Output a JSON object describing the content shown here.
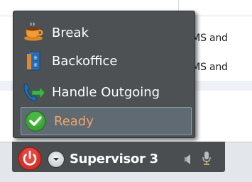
{
  "background_table": {
    "rows": [
      {
        "text": "",
        "has_text": false
      },
      {
        "text": ", SMS and"
      },
      {
        "text": ", SMS and"
      }
    ]
  },
  "status_menu": {
    "items": [
      {
        "label": "Break",
        "icon": "coffee-cup-icon",
        "selected": false
      },
      {
        "label": "Backoffice",
        "icon": "filing-cabinet-icon",
        "selected": false
      },
      {
        "label": "Handle Outgoing",
        "icon": "outgoing-call-icon",
        "selected": false
      },
      {
        "label": "Ready",
        "icon": "checkmark-icon",
        "selected": true
      }
    ]
  },
  "status_bar": {
    "agent_name": "Supervisor 3",
    "power_icon": "power-icon",
    "dropdown_icon": "chevron-down-icon",
    "speaker_icon": "speaker-icon",
    "mic_icon": "microphone-icon"
  },
  "colors": {
    "menu_background": "#4d5154",
    "selected_label": "#f2a36a",
    "power_red": "#d9322b",
    "ready_green": "#3aa534"
  }
}
